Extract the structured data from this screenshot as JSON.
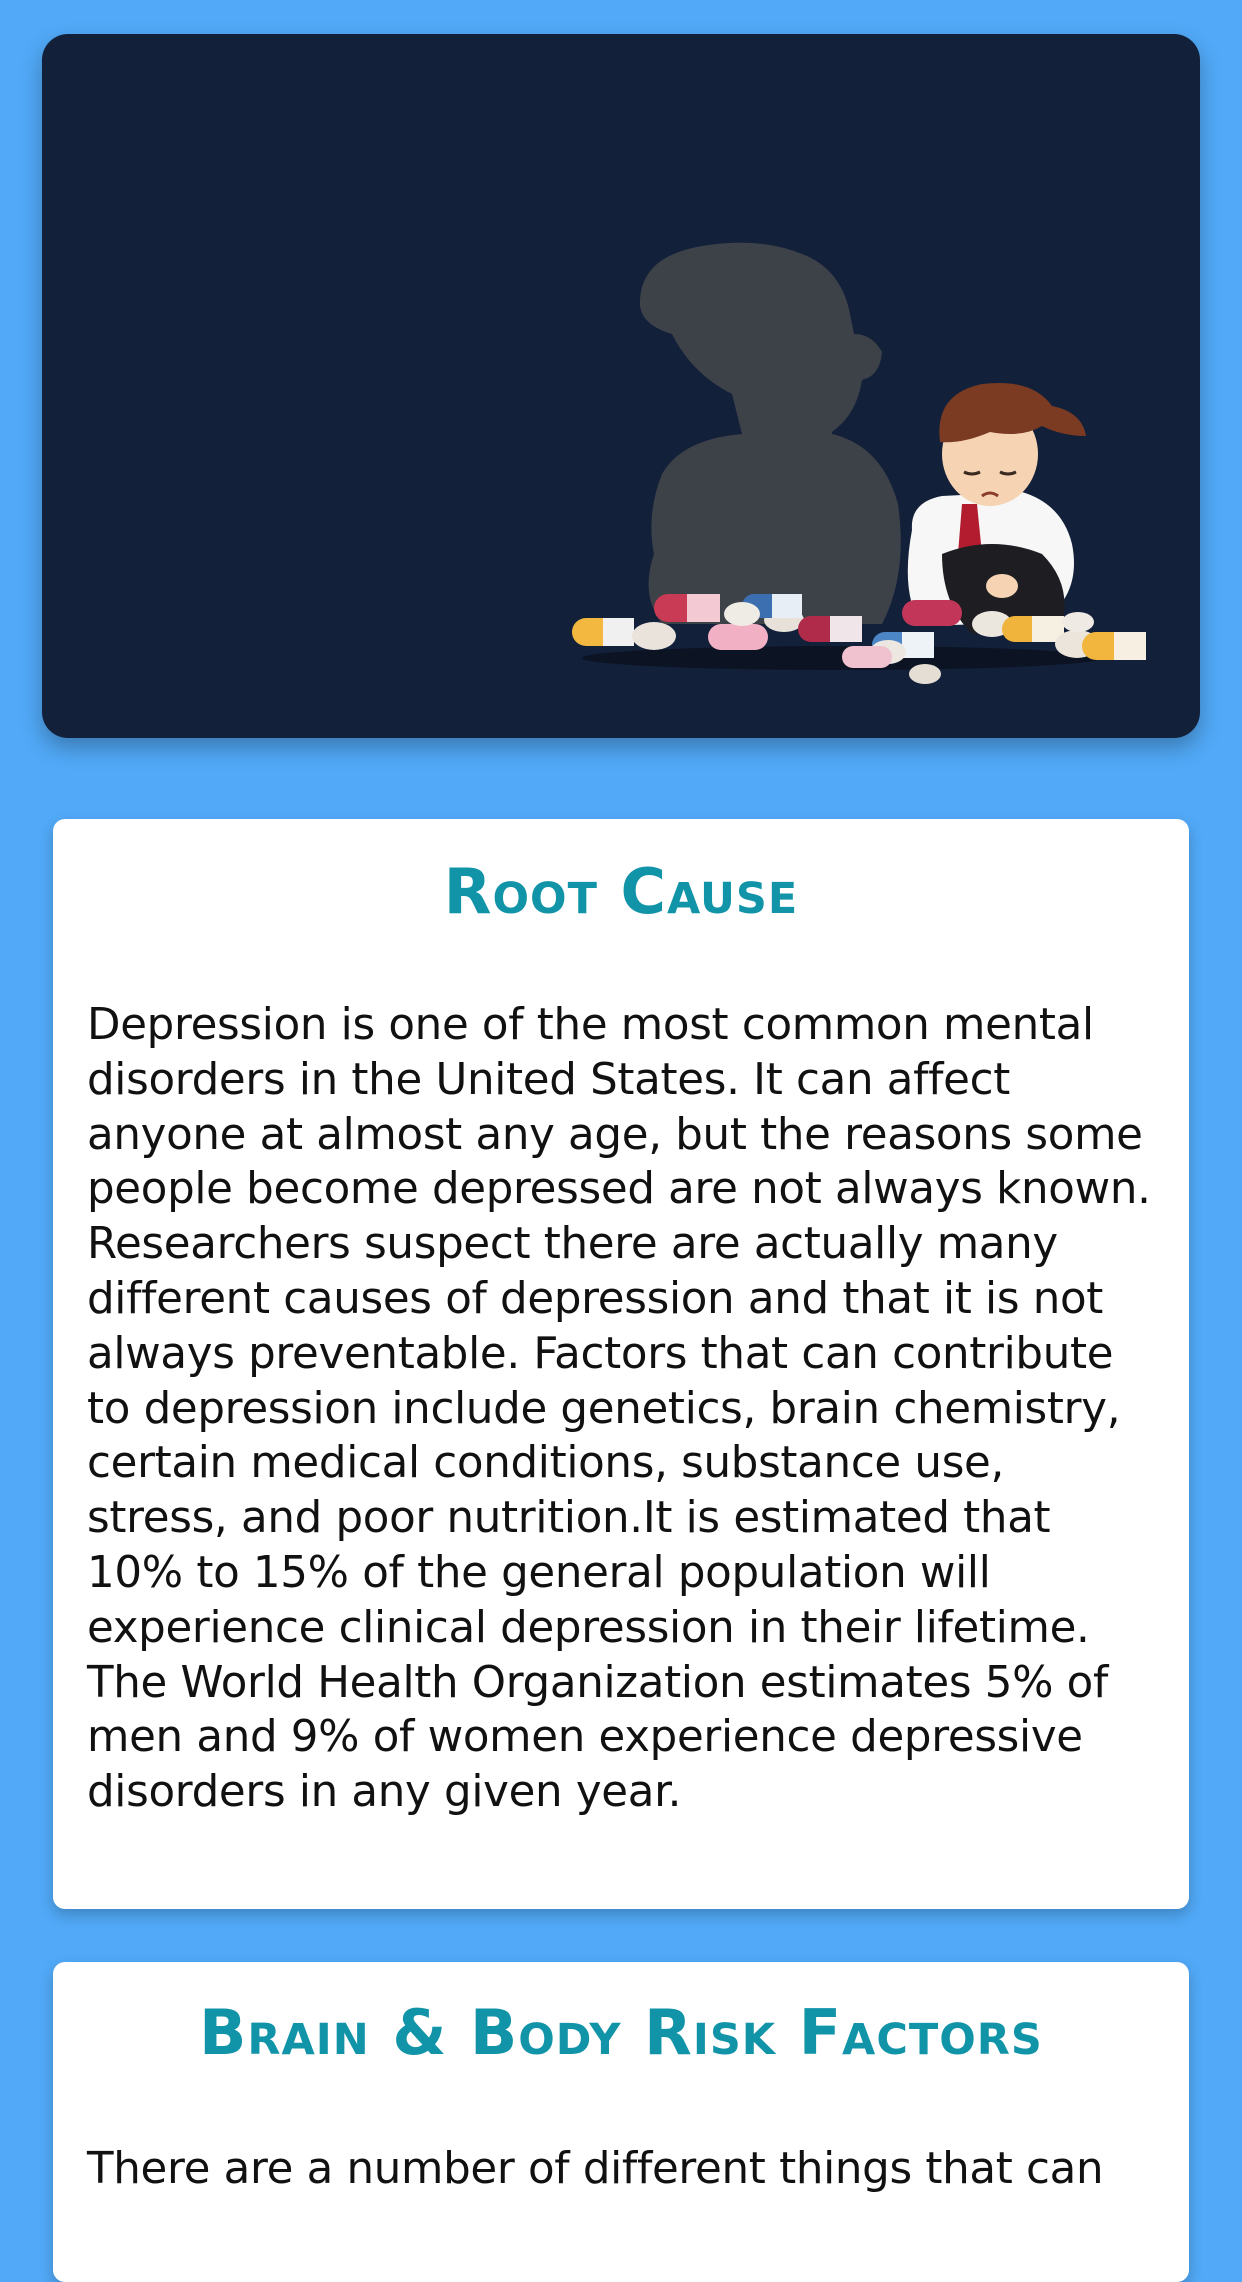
{
  "hero": {
    "illustration": "sad-man-with-pills-illustration"
  },
  "sections": [
    {
      "title": "Root Cause",
      "body": "Depression is one of the most common mental disorders in the United States. It can affect anyone at almost any age, but the reasons some people become depressed are not always known. Researchers suspect there are actually many different causes of depression and that it is not always preventable. Factors that can contribute to depression include genetics, brain chemistry, certain medical conditions, substance use, stress, and poor nutrition.It is estimated that 10% to 15% of the general population will experience clinical depression in their lifetime. The World Health Organization estimates 5% of men and 9% of women experience depressive disorders in any given year."
    },
    {
      "title": "Brain & Body Risk Factors",
      "body": "There are a number of different things that can"
    }
  ],
  "colors": {
    "background": "#51a9f7",
    "hero_background": "#13203a",
    "title": "#1193a8",
    "text": "#111111"
  }
}
